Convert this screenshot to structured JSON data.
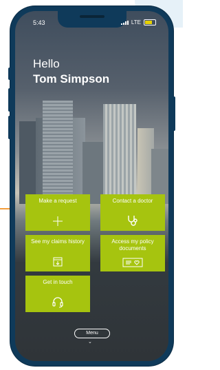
{
  "status_bar": {
    "time": "5:43",
    "network": "LTE"
  },
  "greeting": {
    "hello": "Hello",
    "name": "Tom Simpson"
  },
  "tiles": [
    {
      "label": "Make a request",
      "icon": "plus-icon"
    },
    {
      "label": "Contact a doctor",
      "icon": "stethoscope-icon"
    },
    {
      "label": "See my claims history",
      "icon": "download-box-icon"
    },
    {
      "label": "Access my policy documents",
      "icon": "document-heart-icon"
    },
    {
      "label": "Get in touch",
      "icon": "headset-icon"
    }
  ],
  "menu": {
    "label": "Menu",
    "icon": "chevron-down-icon"
  },
  "colors": {
    "tile": "#a6c40f",
    "frame": "#0f3a5a",
    "accent": "#f39c3a"
  }
}
